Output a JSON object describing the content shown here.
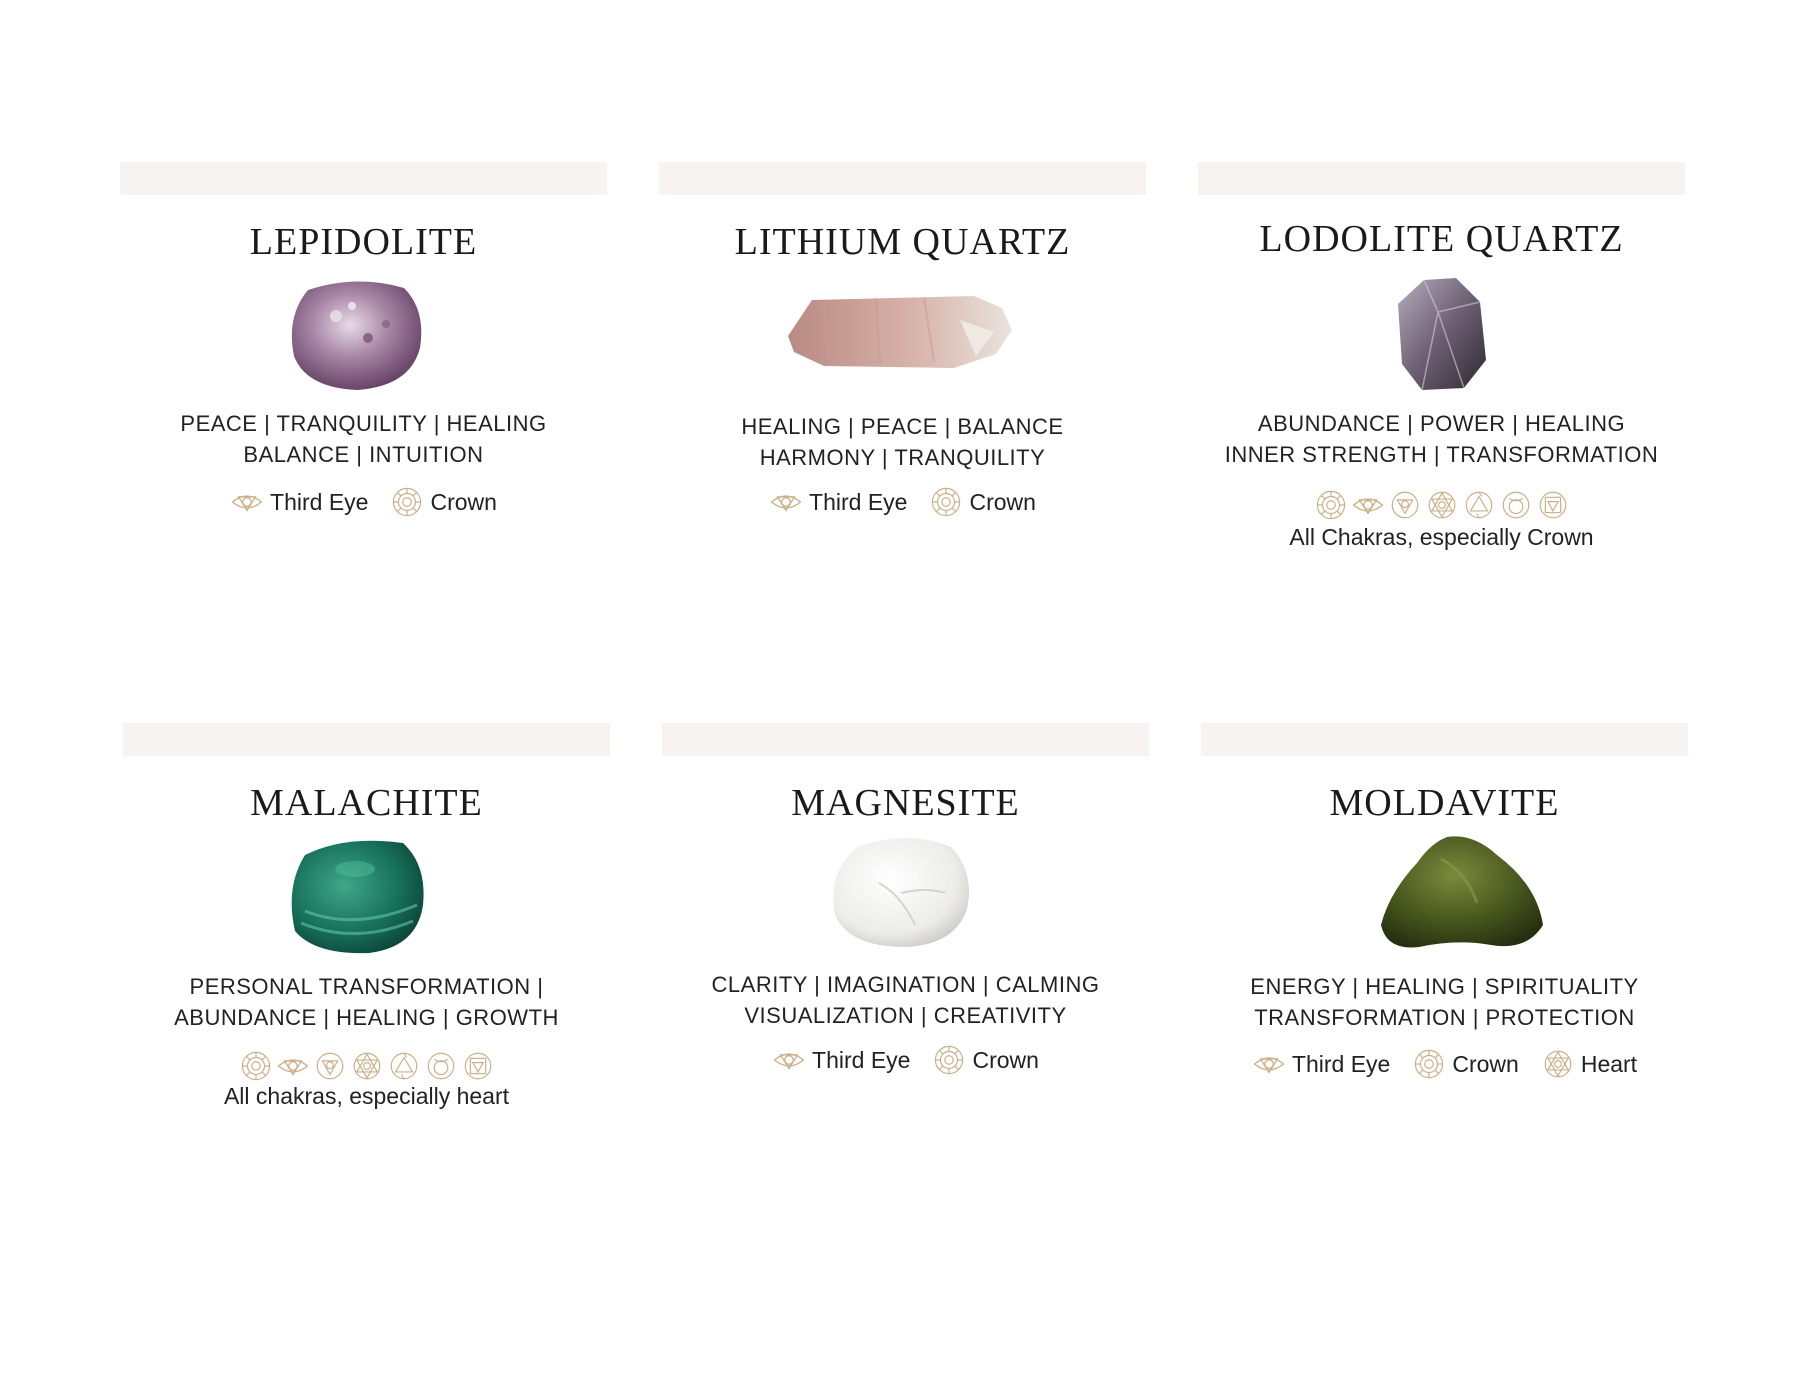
{
  "colors": {
    "band": "#f6f3f2",
    "icon_gold": "#c9b088",
    "text": "#222222"
  },
  "cards": [
    {
      "name": "LEPIDOLITE",
      "props": [
        "PEACE | TRANQUILITY | HEALING",
        "BALANCE | INTUITION"
      ],
      "chakras": [
        {
          "icon": "third-eye-icon",
          "label": "Third Eye"
        },
        {
          "icon": "crown-icon",
          "label": "Crown"
        }
      ]
    },
    {
      "name": "LITHIUM QUARTZ",
      "props": [
        "HEALING | PEACE | BALANCE",
        "HARMONY | TRANQUILITY"
      ],
      "chakras": [
        {
          "icon": "third-eye-icon",
          "label": "Third Eye"
        },
        {
          "icon": "crown-icon",
          "label": "Crown"
        }
      ]
    },
    {
      "name": "LODOLITE QUARTZ",
      "props": [
        "ABUNDANCE | POWER | HEALING",
        "INNER STRENGTH | TRANSFORMATION"
      ],
      "chakra_note": "All Chakras, especially Crown"
    },
    {
      "name": "MALACHITE",
      "props": [
        "PERSONAL TRANSFORMATION |",
        "ABUNDANCE | HEALING | GROWTH"
      ],
      "chakra_note": "All chakras, especially heart"
    },
    {
      "name": "MAGNESITE",
      "props": [
        "CLARITY | IMAGINATION | CALMING",
        "VISUALIZATION | CREATIVITY"
      ],
      "chakras": [
        {
          "icon": "third-eye-icon",
          "label": "Third Eye"
        },
        {
          "icon": "crown-icon",
          "label": "Crown"
        }
      ]
    },
    {
      "name": "MOLDAVITE",
      "props": [
        "ENERGY | HEALING | SPIRITUALITY",
        "TRANSFORMATION | PROTECTION"
      ],
      "chakras": [
        {
          "icon": "third-eye-icon",
          "label": "Third Eye"
        },
        {
          "icon": "crown-icon",
          "label": "Crown"
        },
        {
          "icon": "heart-icon",
          "label": "Heart"
        }
      ]
    }
  ]
}
